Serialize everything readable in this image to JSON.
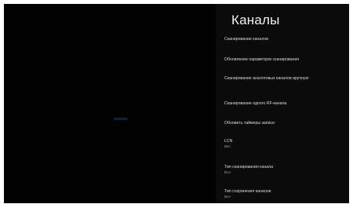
{
  "panel": {
    "title": "Каналы",
    "items": [
      {
        "label": "Сканирование каналов"
      },
      {
        "label": "Обновление параметров сканирования"
      },
      {
        "label": "Сканирование аналоговых каналов вручную"
      },
      {
        "label": "Сканирование одного RF-канала"
      },
      {
        "label": "Обновить таймеры записи"
      },
      {
        "label": "LCN",
        "value": "Вкл"
      },
      {
        "label": "Тип сканирования канала",
        "value": "Все"
      },
      {
        "label": "Тип сохранения каналов",
        "value": "Все"
      }
    ]
  },
  "colors": {
    "background": "#000000",
    "panel": "#0b0b0b",
    "text": "#dcdcdc",
    "value_text": "#9a9a9a",
    "preview_glow": "#1a2a55"
  }
}
